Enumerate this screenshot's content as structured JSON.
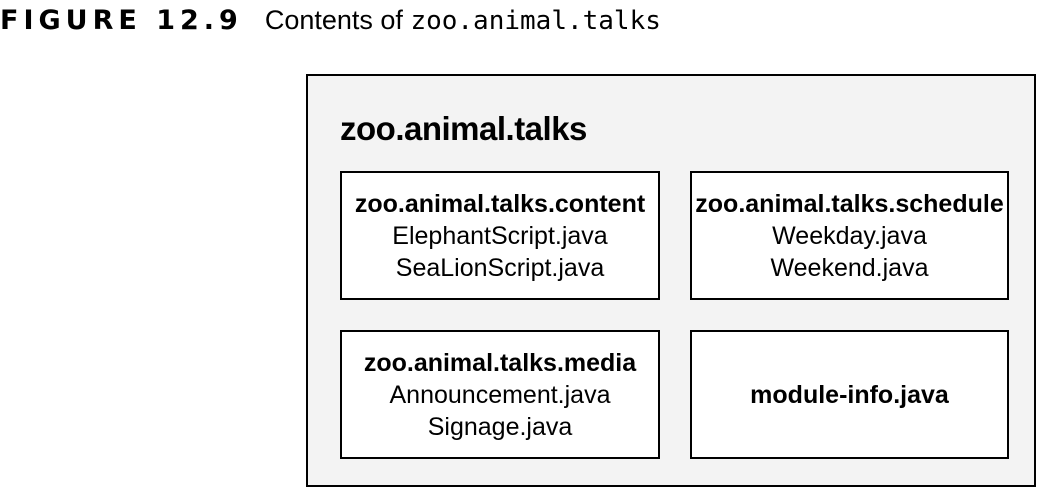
{
  "caption": {
    "label": "FIGURE 12.9",
    "text": "Contents of",
    "code": "zoo.animal.talks"
  },
  "module": {
    "title": "zoo.animal.talks",
    "packages": [
      {
        "name": "zoo.animal.talks.content",
        "files": [
          "ElephantScript.java",
          "SeaLionScript.java"
        ]
      },
      {
        "name": "zoo.animal.talks.schedule",
        "files": [
          "Weekday.java",
          "Weekend.java"
        ]
      },
      {
        "name": "zoo.animal.talks.media",
        "files": [
          "Announcement.java",
          "Signage.java"
        ]
      }
    ],
    "module_info": "module-info.java"
  }
}
